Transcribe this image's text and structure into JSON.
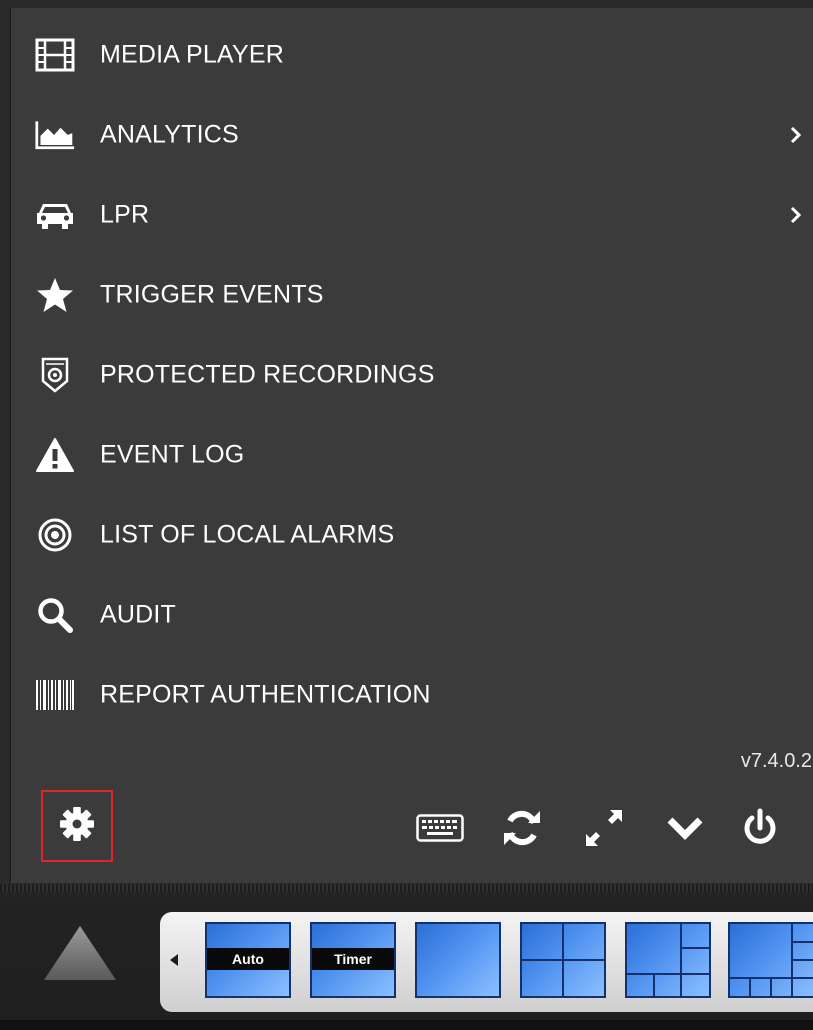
{
  "menu": {
    "items": [
      {
        "label": "MEDIA PLAYER",
        "icon": "film-icon",
        "has_submenu": false
      },
      {
        "label": "ANALYTICS",
        "icon": "area-chart-icon",
        "has_submenu": true
      },
      {
        "label": "LPR",
        "icon": "car-icon",
        "has_submenu": true
      },
      {
        "label": "TRIGGER EVENTS",
        "icon": "star-icon",
        "has_submenu": false
      },
      {
        "label": "PROTECTED RECORDINGS",
        "icon": "shield-icon",
        "has_submenu": false
      },
      {
        "label": "EVENT LOG",
        "icon": "warning-icon",
        "has_submenu": false
      },
      {
        "label": "LIST OF LOCAL ALARMS",
        "icon": "target-icon",
        "has_submenu": false
      },
      {
        "label": "AUDIT",
        "icon": "search-icon",
        "has_submenu": false
      },
      {
        "label": "REPORT AUTHENTICATION",
        "icon": "barcode-icon",
        "has_submenu": false
      }
    ]
  },
  "version": "v7.4.0.2",
  "toolbar": {
    "settings_icon": "gear-icon",
    "settings_highlight_color": "#e0242a",
    "tools": [
      "keyboard-icon",
      "refresh-icon",
      "fullscreen-icon",
      "chevron-down-icon",
      "power-icon"
    ]
  },
  "layouts": {
    "auto_label": "Auto",
    "timer_label": "Timer",
    "buttons": [
      "layout-auto",
      "layout-timer",
      "layout-1x1",
      "layout-2x2",
      "layout-1-plus-5",
      "layout-1-plus-7"
    ]
  },
  "colors": {
    "panel_bg": "#3b3b3b",
    "text": "#ffffff",
    "layout_blue": "#4f92ef"
  }
}
